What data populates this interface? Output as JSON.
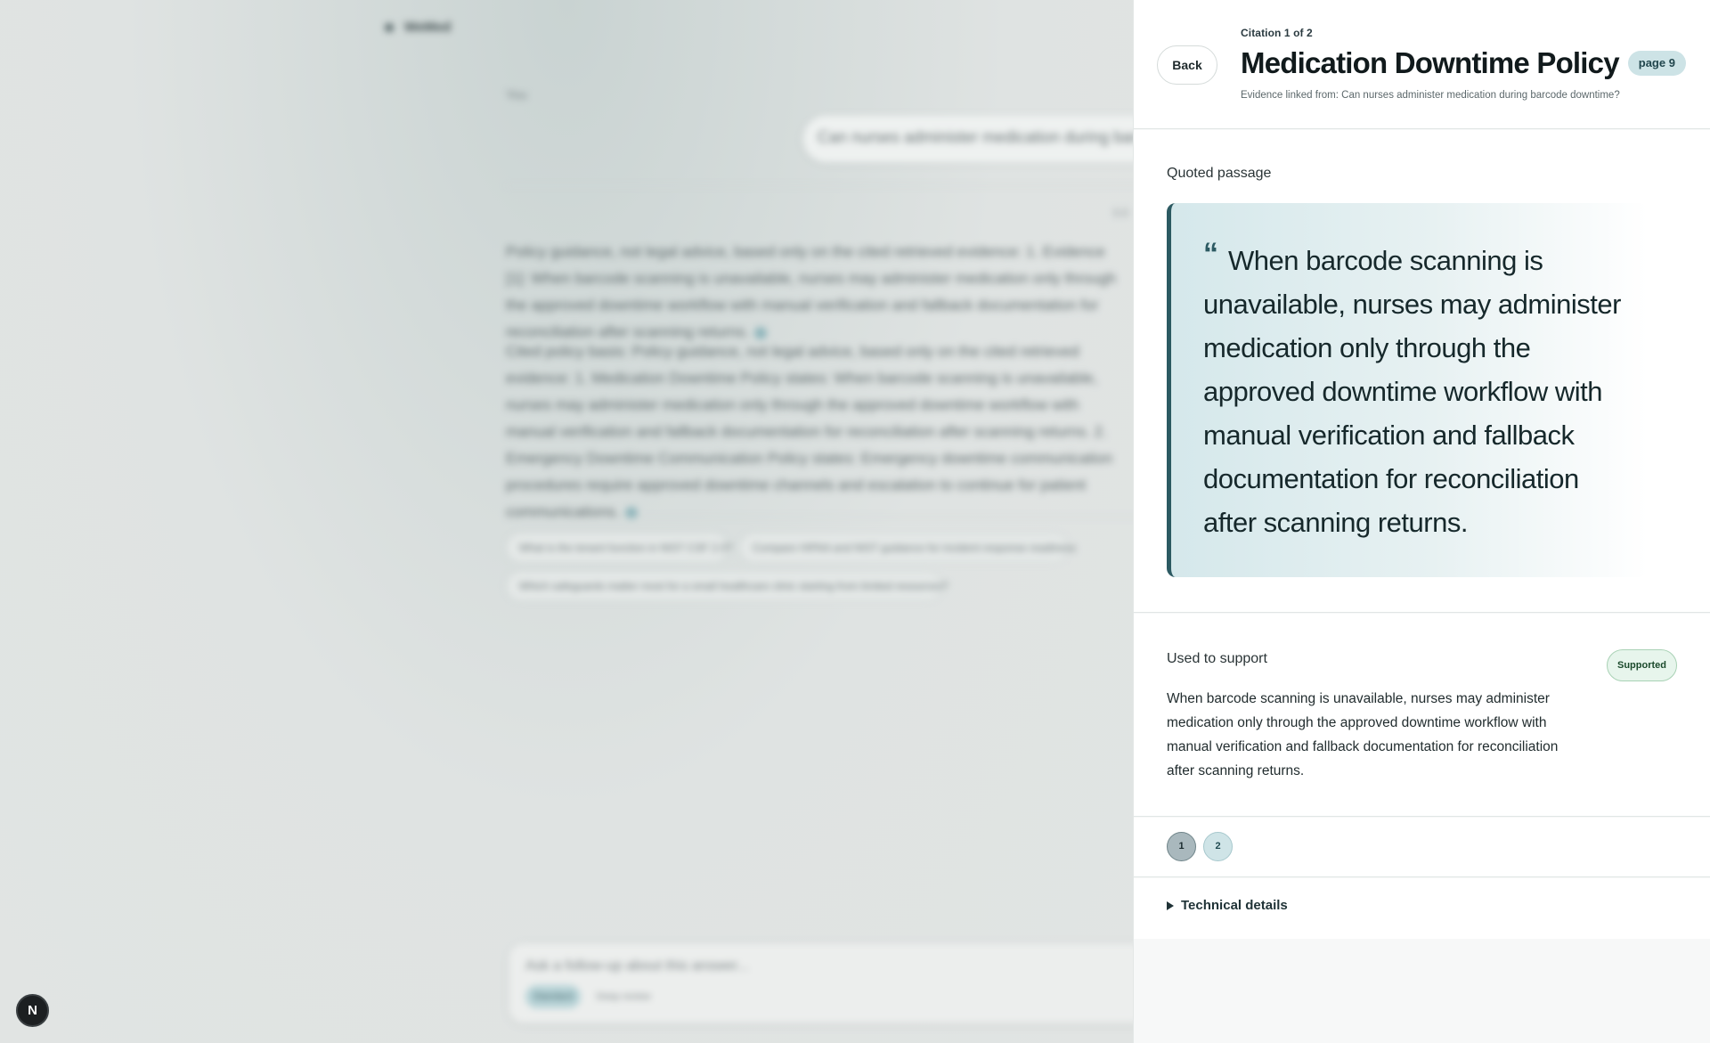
{
  "background": {
    "brand": "WeMed",
    "you_label": "You",
    "user_message": "Can nurses administer medication during barcode downtime?",
    "answer_meta": "0.0",
    "paragraph1": "Policy guidance, not legal advice, based only on the cited retrieved evidence: 1. Evidence [1]: When barcode scanning is unavailable, nurses may administer medication only through the approved downtime workflow with manual verification and fallback documentation for reconciliation after scanning returns.",
    "paragraph2": "Cited policy basis: Policy guidance, not legal advice, based only on the cited retrieved evidence: 1. Medication Downtime Policy states: When barcode scanning is unavailable, nurses may administer medication only through the approved downtime workflow with manual verification and fallback documentation for reconciliation after scanning returns. 2. Emergency Downtime Communication Policy states: Emergency downtime communication procedures require approved downtime channels and escalation to continue for patient communications.",
    "suggestions": [
      "What is the tenant function in NIST CSF 2.0?",
      "Compare HIPAA and NIST guidance for incident response readiness",
      "Which safeguards matter most for a small healthcare clinic starting from limited resources?"
    ],
    "composer_placeholder": "Ask a follow-up about this answer...",
    "composer_mode_active": "Standard",
    "composer_mode_other": "Deep review"
  },
  "corner_badge": "N",
  "panel": {
    "back_label": "Back",
    "citation_counter": "Citation 1 of 2",
    "title": "Medication Downtime Policy",
    "page_badge": "page 9",
    "evidence_line": "Evidence linked from: Can nurses administer medication during barcode downtime?",
    "quoted_label": "Quoted passage",
    "quote_mark": "“",
    "quote_text": "When barcode scanning is unavailable, nurses may administer medication only through the approved downtime workflow with manual verification and fallback documentation for reconciliation after scanning returns.",
    "support_label": "Used to support",
    "support_status": "Supported",
    "support_text": "When barcode scanning is unavailable, nurses may administer medication only through the approved downtime workflow with manual verification and fallback documentation for reconciliation after scanning returns.",
    "pages": [
      "1",
      "2"
    ],
    "technical_label": "Technical details"
  },
  "colors": {
    "accent": "#2c5a62",
    "supported_bg": "#e7f5ec",
    "page_badge_bg": "#cde3e6"
  }
}
